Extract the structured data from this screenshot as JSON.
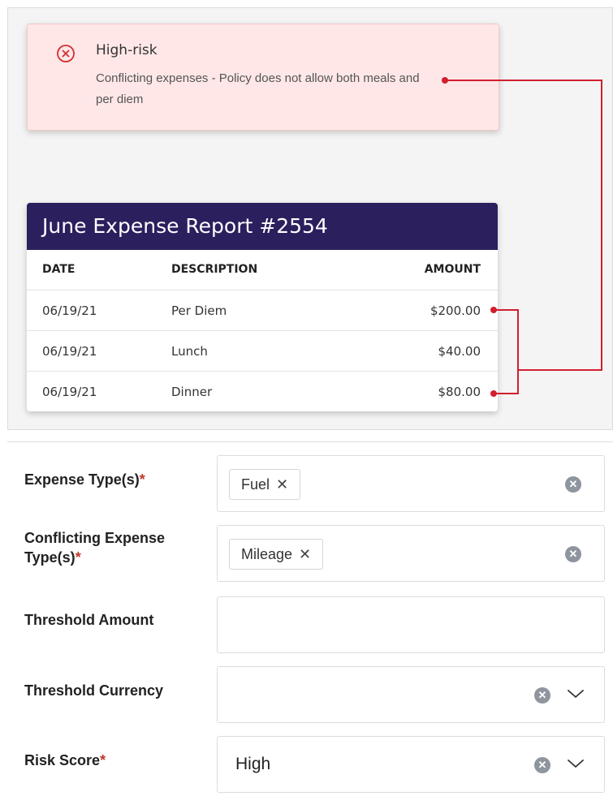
{
  "alert": {
    "icon": "error-circle-icon",
    "title": "High-risk",
    "message": "Conflicting expenses - Policy does not allow both meals and per diem",
    "color": "#d32f2f"
  },
  "report": {
    "title": "June Expense Report #2554",
    "columns": [
      "DATE",
      "DESCRIPTION",
      "AMOUNT"
    ],
    "rows": [
      {
        "date": "06/19/21",
        "description": "Per Diem",
        "amount": "$200.00"
      },
      {
        "date": "06/19/21",
        "description": "Lunch",
        "amount": "$40.00"
      },
      {
        "date": "06/19/21",
        "description": "Dinner",
        "amount": "$80.00"
      }
    ],
    "header_color": "#2b1f5e"
  },
  "form": {
    "expense_types": {
      "label": "Expense Type(s)",
      "required": "*",
      "tags": [
        "Fuel"
      ]
    },
    "conflicting_types": {
      "label_line1": "Conflicting Expense",
      "label_line2": "Type(s)",
      "required": "*",
      "tags": [
        "Mileage"
      ]
    },
    "threshold_amount": {
      "label": "Threshold Amount",
      "value": ""
    },
    "threshold_currency": {
      "label": "Threshold Currency",
      "value": ""
    },
    "risk_score": {
      "label": "Risk Score",
      "required": "*",
      "value": "High"
    },
    "tag_remove_glyph": "✕",
    "clear_glyph": "✕"
  }
}
